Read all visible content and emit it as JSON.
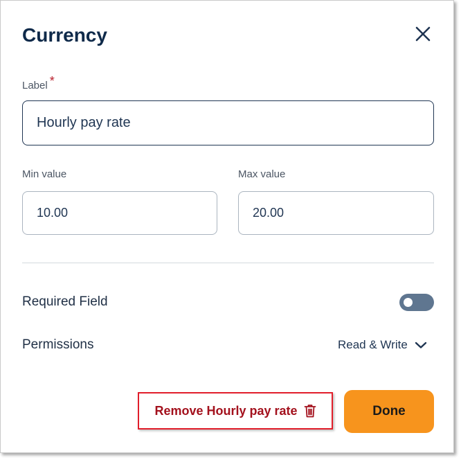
{
  "dialog": {
    "title": "Currency",
    "close_icon": "close-icon"
  },
  "label_field": {
    "label": "Label",
    "required_marker": "*",
    "value": "Hourly pay rate"
  },
  "min_field": {
    "label": "Min value",
    "value": "10.00"
  },
  "max_field": {
    "label": "Max value",
    "value": "20.00"
  },
  "required_field": {
    "label": "Required Field",
    "enabled": false
  },
  "permissions": {
    "label": "Permissions",
    "selected": "Read & Write",
    "icon": "chevron-down-icon"
  },
  "actions": {
    "remove_label": "Remove Hourly pay rate",
    "remove_icon": "trash-icon",
    "done_label": "Done"
  },
  "colors": {
    "title": "#0f2a4a",
    "danger": "#a3111d",
    "highlight_border": "#e11d2a",
    "primary_button": "#f7941d",
    "toggle_off": "#5f7690"
  }
}
